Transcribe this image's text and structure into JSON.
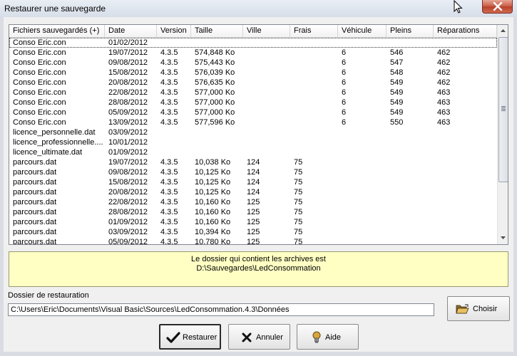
{
  "window": {
    "title": "Restaurer une sauvegarde"
  },
  "table": {
    "columns": [
      "Fichiers sauvegardés (+)",
      "Date",
      "Version",
      "Taille",
      "Ville",
      "Frais",
      "Véhicule",
      "Pleins",
      "Réparations"
    ],
    "rows": [
      [
        "Conso Eric.con",
        "01/02/2012",
        "",
        "",
        "",
        "",
        "",
        "",
        ""
      ],
      [
        "Conso Eric.con",
        "19/07/2012",
        "4.3.5",
        "574,848 Ko",
        "",
        "",
        "6",
        "546",
        "462"
      ],
      [
        "Conso Eric.con",
        "09/08/2012",
        "4.3.5",
        "575,443 Ko",
        "",
        "",
        "6",
        "547",
        "462"
      ],
      [
        "Conso Eric.con",
        "15/08/2012",
        "4.3.5",
        "576,039 Ko",
        "",
        "",
        "6",
        "548",
        "462"
      ],
      [
        "Conso Eric.con",
        "20/08/2012",
        "4.3.5",
        "576,635 Ko",
        "",
        "",
        "6",
        "549",
        "462"
      ],
      [
        "Conso Eric.con",
        "22/08/2012",
        "4.3.5",
        "577,000 Ko",
        "",
        "",
        "6",
        "549",
        "463"
      ],
      [
        "Conso Eric.con",
        "28/08/2012",
        "4.3.5",
        "577,000 Ko",
        "",
        "",
        "6",
        "549",
        "463"
      ],
      [
        "Conso Eric.con",
        "05/09/2012",
        "4.3.5",
        "577,000 Ko",
        "",
        "",
        "6",
        "549",
        "463"
      ],
      [
        "Conso Eric.con",
        "13/09/2012",
        "4.3.5",
        "577,596 Ko",
        "",
        "",
        "6",
        "550",
        "463"
      ],
      [
        "licence_personnelle.dat",
        "03/09/2012",
        "",
        "",
        "",
        "",
        "",
        "",
        ""
      ],
      [
        "licence_professionnelle....",
        "10/01/2012",
        "",
        "",
        "",
        "",
        "",
        "",
        ""
      ],
      [
        "licence_ultimate.dat",
        "01/09/2012",
        "",
        "",
        "",
        "",
        "",
        "",
        ""
      ],
      [
        "parcours.dat",
        "19/07/2012",
        "4.3.5",
        "10,038 Ko",
        "124",
        "75",
        "",
        "",
        ""
      ],
      [
        "parcours.dat",
        "09/08/2012",
        "4.3.5",
        "10,125 Ko",
        "124",
        "75",
        "",
        "",
        ""
      ],
      [
        "parcours.dat",
        "15/08/2012",
        "4.3.5",
        "10,125 Ko",
        "124",
        "75",
        "",
        "",
        ""
      ],
      [
        "parcours.dat",
        "20/08/2012",
        "4.3.5",
        "10,125 Ko",
        "124",
        "75",
        "",
        "",
        ""
      ],
      [
        "parcours.dat",
        "22/08/2012",
        "4.3.5",
        "10,160 Ko",
        "125",
        "75",
        "",
        "",
        ""
      ],
      [
        "parcours.dat",
        "28/08/2012",
        "4.3.5",
        "10,160 Ko",
        "125",
        "75",
        "",
        "",
        ""
      ],
      [
        "parcours.dat",
        "01/09/2012",
        "4.3.5",
        "10,160 Ko",
        "125",
        "75",
        "",
        "",
        ""
      ],
      [
        "parcours.dat",
        "03/09/2012",
        "4.3.5",
        "10,394 Ko",
        "125",
        "75",
        "",
        "",
        ""
      ],
      [
        "parcours.dat",
        "05/09/2012",
        "4.3.5",
        "10,780 Ko",
        "125",
        "75",
        "",
        "",
        ""
      ]
    ]
  },
  "info": {
    "line1": "Le dossier qui contient les archives est",
    "line2": "D:\\Sauvegardes\\LedConsommation"
  },
  "destination": {
    "label": "Dossier de restauration",
    "value": "C:\\Users\\Eric\\Documents\\Visual Basic\\Sources\\LedConsommation.4.3\\Données"
  },
  "buttons": {
    "choisir": "Choisir",
    "restaurer": "Restaurer",
    "annuler": "Annuler",
    "aide": "Aide"
  },
  "icons": {
    "close": "close-icon",
    "folder": "open-folder-icon",
    "check": "checkmark-icon",
    "cancel": "cross-icon",
    "help": "lightbulb-icon"
  },
  "colors": {
    "info_background": "#ffffc4",
    "close_button": "#c75b45"
  }
}
